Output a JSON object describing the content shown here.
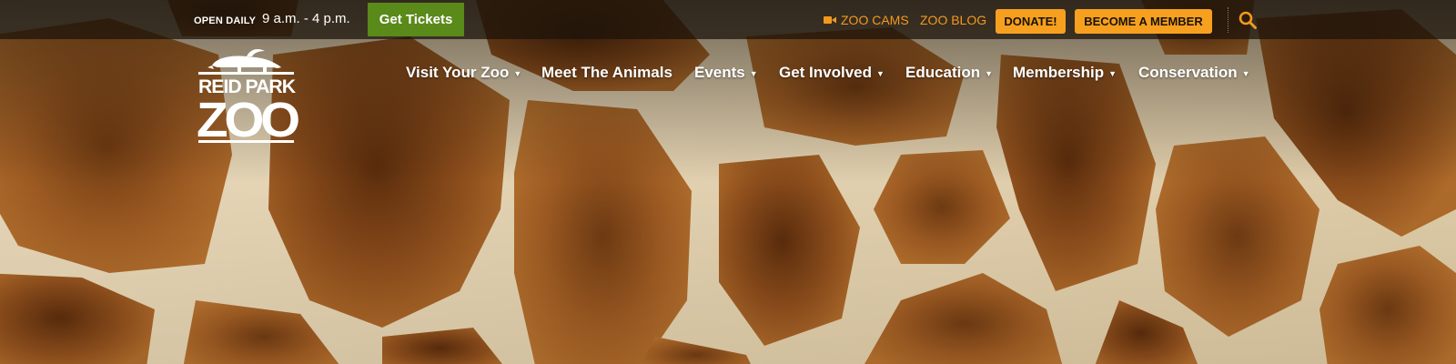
{
  "topbar": {
    "hours_label": "OPEN DAILY",
    "hours_value": "9 a.m. - 4 p.m.",
    "tickets_label": "Get Tickets",
    "zoo_cams_label": "ZOO CAMS",
    "zoo_blog_label": "ZOO BLOG",
    "donate_label": "DONATE!",
    "member_label": "BECOME A MEMBER"
  },
  "logo": {
    "line1": "REID PARK",
    "line2": "ZOO"
  },
  "nav": {
    "items": [
      {
        "label": "Visit Your Zoo",
        "has_dropdown": true
      },
      {
        "label": "Meet The Animals",
        "has_dropdown": false
      },
      {
        "label": "Events",
        "has_dropdown": true
      },
      {
        "label": "Get Involved",
        "has_dropdown": true
      },
      {
        "label": "Education",
        "has_dropdown": true
      },
      {
        "label": "Membership",
        "has_dropdown": true
      },
      {
        "label": "Conservation",
        "has_dropdown": true
      }
    ],
    "caret": "▼"
  },
  "colors": {
    "accent_orange": "#f7a01f",
    "tickets_green": "#5a8a1a",
    "link_orange": "#f29a1e"
  },
  "icons": [
    "video-camera-icon",
    "search-icon",
    "chevron-down-icon"
  ]
}
